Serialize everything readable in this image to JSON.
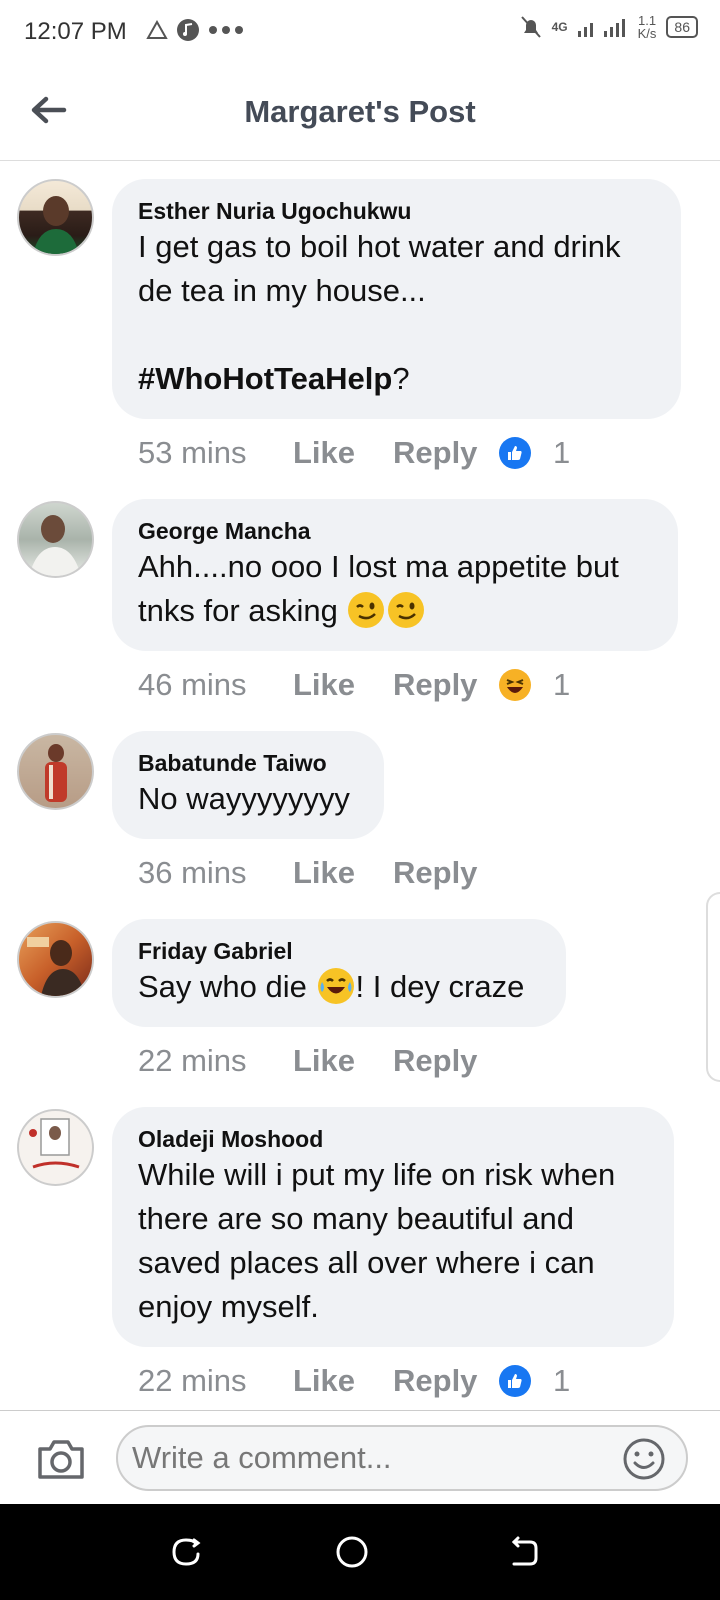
{
  "status_bar": {
    "time": "12:07 PM",
    "network": "4G",
    "speed_top": "1.1",
    "speed_unit": "K/s",
    "battery": "86"
  },
  "header": {
    "title": "Margaret's Post"
  },
  "comments": [
    {
      "author": "Esther Nuria Ugochukwu",
      "text": "I get gas to boil hot water and drink de tea in my house...\n\n",
      "hashtag": "#WhoHotTeaHelp",
      "after_tag": "?",
      "time": "53 mins",
      "like_label": "Like",
      "reply_label": "Reply",
      "reaction": "like-reaction",
      "reaction_count": "1"
    },
    {
      "author": "George Mancha",
      "text": "Ahh....no ooo I lost ma appetite but tnks for asking ",
      "time": "46 mins",
      "like_label": "Like",
      "reply_label": "Reply",
      "reaction": "haha-reaction",
      "reaction_count": "1"
    },
    {
      "author": "Babatunde Taiwo",
      "text": "No wayyyyyyyy",
      "time": "36 mins",
      "like_label": "Like",
      "reply_label": "Reply"
    },
    {
      "author": "Friday Gabriel",
      "text_before": "Say who die ",
      "text_after": "! I dey craze",
      "time": "22 mins",
      "like_label": "Like",
      "reply_label": "Reply"
    },
    {
      "author": "Oladeji Moshood",
      "text": "While will i put my life on risk when there are so many beautiful and saved places all over where i can enjoy myself.",
      "time": "22 mins",
      "like_label": "Like",
      "reply_label": "Reply",
      "reaction": "like-reaction",
      "reaction_count": "1"
    }
  ],
  "composer": {
    "placeholder": "Write a comment..."
  },
  "colors": {
    "like_blue": "#1877f2",
    "bubble_bg": "#f0f2f5",
    "meta_gray": "#8a8d91"
  }
}
